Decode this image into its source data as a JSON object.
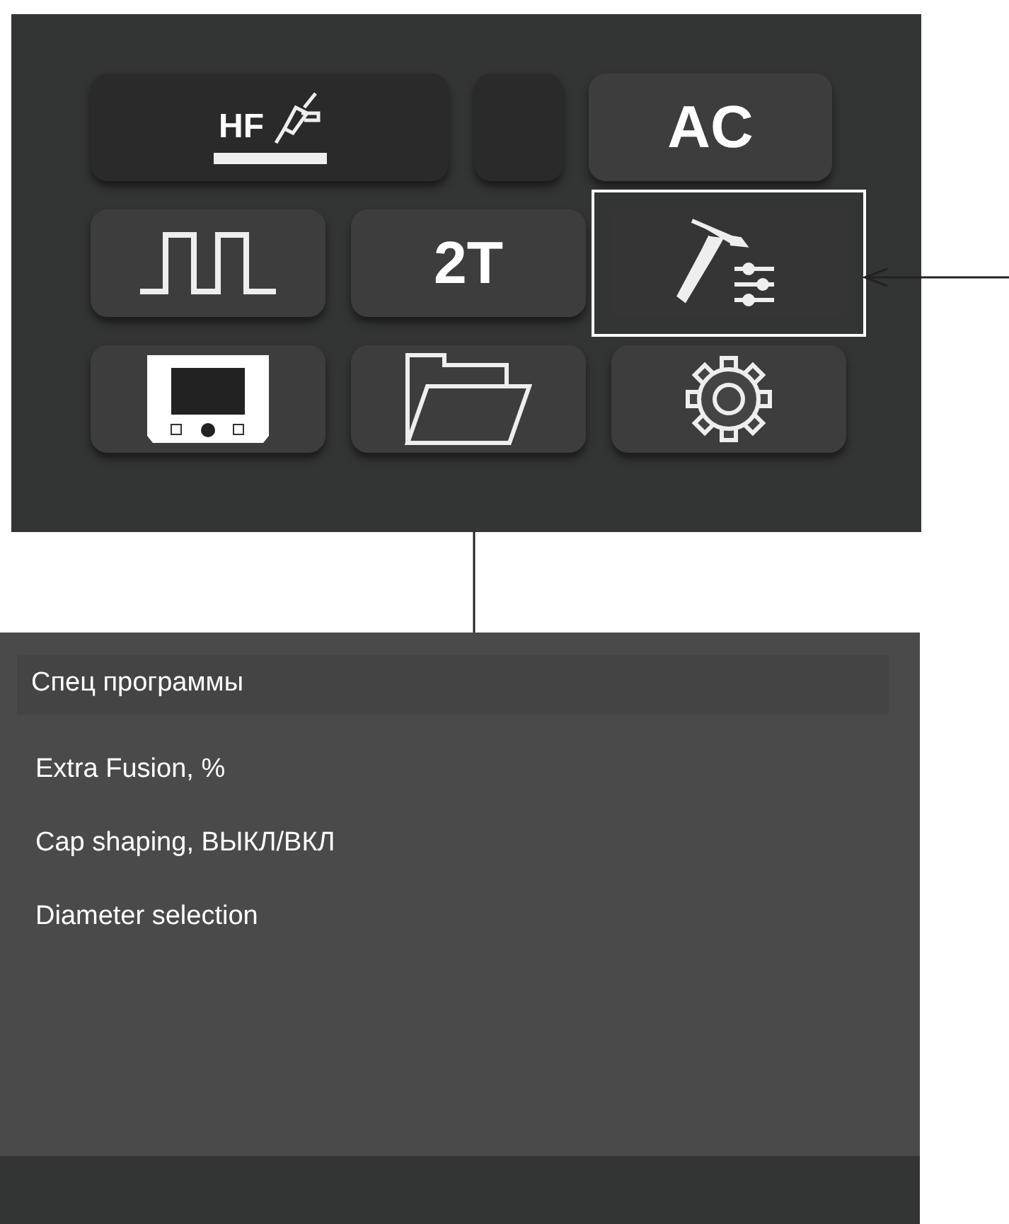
{
  "screen": {
    "rows": [
      [
        {
          "kind": "hf",
          "label": "HF",
          "selected": false
        },
        {
          "kind": "blank",
          "selected": false
        },
        {
          "kind": "text",
          "label": "AC",
          "selected": false
        }
      ],
      [
        {
          "kind": "pulse",
          "selected": false
        },
        {
          "kind": "text",
          "label": "2T",
          "selected": false
        },
        {
          "kind": "torch-settings",
          "selected": true
        }
      ],
      [
        {
          "kind": "device",
          "selected": false
        },
        {
          "kind": "folder",
          "selected": false
        },
        {
          "kind": "gear",
          "selected": false
        }
      ]
    ]
  },
  "menu": {
    "title": "Спец программы",
    "items": [
      {
        "label": "Extra Fusion, %"
      },
      {
        "label": "Cap shaping, ВЫКЛ/ВКЛ"
      },
      {
        "label": "Diameter selection"
      }
    ]
  }
}
